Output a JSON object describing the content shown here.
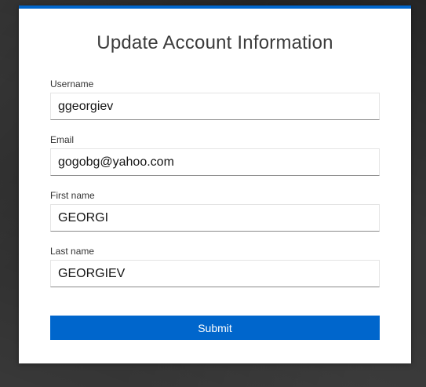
{
  "form": {
    "title": "Update Account Information",
    "fields": [
      {
        "label": "Username",
        "value": "ggeorgiev"
      },
      {
        "label": "Email",
        "value": "gogobg@yahoo.com"
      },
      {
        "label": "First name",
        "value": "GEORGI"
      },
      {
        "label": "Last name",
        "value": "GEORGIEV"
      }
    ],
    "submit_label": "Submit"
  },
  "colors": {
    "accent": "#0066cc",
    "background": "#2c2c2c",
    "card": "#ffffff"
  }
}
